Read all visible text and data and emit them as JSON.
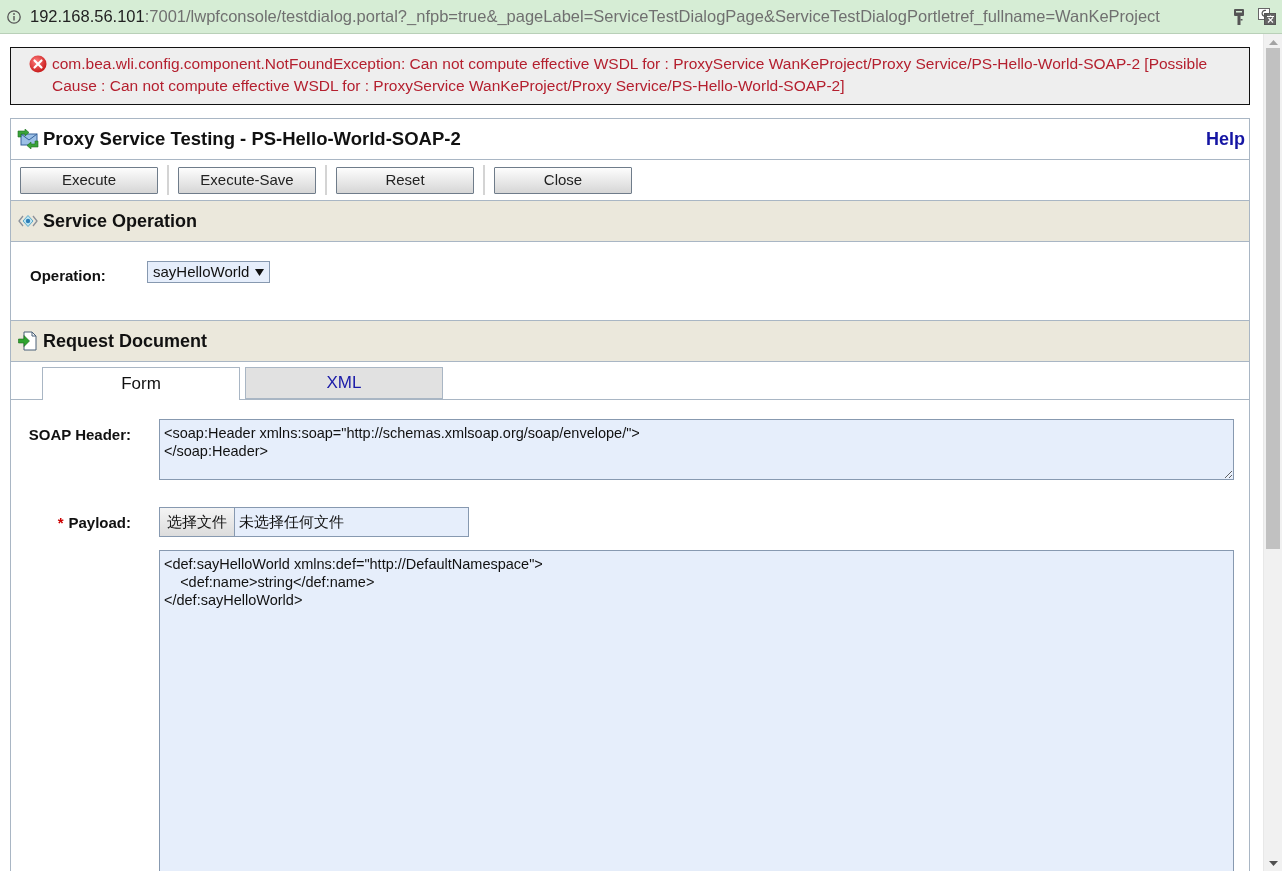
{
  "address_bar": {
    "host": "192.168.56.101",
    "path": ":7001/lwpfconsole/testdialog.portal?_nfpb=true&_pageLabel=ServiceTestDialogPage&ServiceTestDialogPortletref_fullname=WanKeProject"
  },
  "error": {
    "message": "com.bea.wli.config.component.NotFoundException: Can not compute effective WSDL for : ProxyService WanKeProject/Proxy Service/PS-Hello-World-SOAP-2 [Possible Cause : Can not compute effective WSDL for : ProxyService WanKeProject/Proxy Service/PS-Hello-World-SOAP-2]"
  },
  "dialog": {
    "title": "Proxy Service Testing - PS-Hello-World-SOAP-2",
    "help": "Help",
    "buttons": [
      "Execute",
      "Execute-Save",
      "Reset",
      "Close"
    ]
  },
  "service_operation": {
    "title": "Service Operation",
    "operation": {
      "label": "Operation:",
      "value": "sayHelloWorld"
    }
  },
  "request_document": {
    "title": "Request Document",
    "tabs": [
      {
        "label": "Form",
        "selected": true
      },
      {
        "label": "XML",
        "selected": false
      }
    ],
    "soap_header": {
      "label": "SOAP Header:",
      "value": "<soap:Header xmlns:soap=\"http://schemas.xmlsoap.org/soap/envelope/\">\n</soap:Header>"
    },
    "payload": {
      "required_mark": "*",
      "label": "Payload:",
      "file_button": "选择文件",
      "file_status": "未选择任何文件",
      "value": "<def:sayHelloWorld xmlns:def=\"http://DefaultNamespace\">\n    <def:name>string</def:name>\n</def:sayHelloWorld>"
    }
  }
}
